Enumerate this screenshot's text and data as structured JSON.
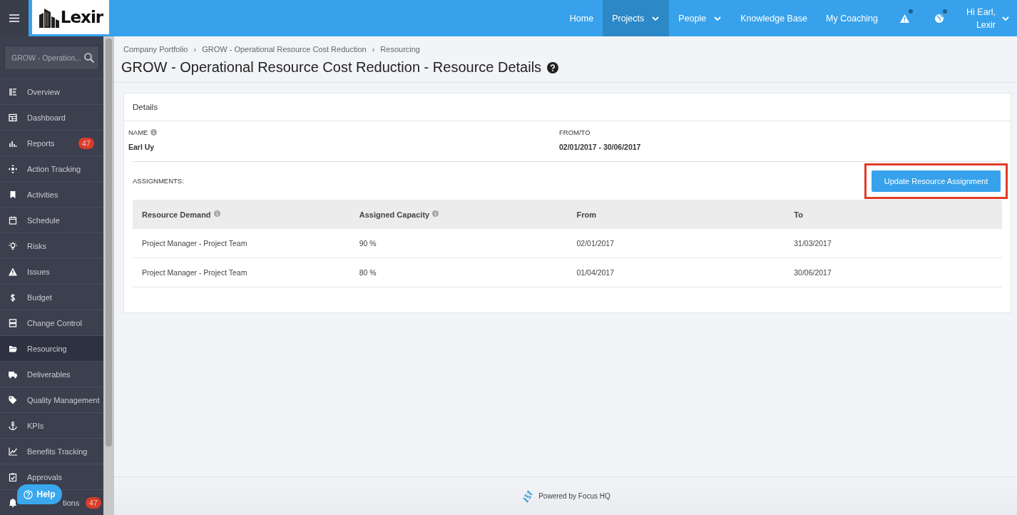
{
  "topbar": {
    "logo": "Lexir",
    "nav": [
      {
        "label": "Home",
        "selected": false,
        "dropdown": false
      },
      {
        "label": "Projects",
        "selected": true,
        "dropdown": true
      },
      {
        "label": "People",
        "selected": false,
        "dropdown": true
      },
      {
        "label": "Knowledge Base",
        "selected": false,
        "dropdown": false
      },
      {
        "label": "My Coaching",
        "selected": false,
        "dropdown": false
      }
    ],
    "user": {
      "greeting": "Hi Earl,",
      "name": "Lexir"
    }
  },
  "sidebar": {
    "search": {
      "value": "GROW - Operation..."
    },
    "items": [
      {
        "label": "Overview",
        "selected": false
      },
      {
        "label": "Dashboard",
        "selected": false
      },
      {
        "label": "Reports",
        "selected": false,
        "badge": "47"
      },
      {
        "label": "Action Tracking",
        "selected": false
      },
      {
        "label": "Activities",
        "selected": false
      },
      {
        "label": "Schedule",
        "selected": false
      },
      {
        "label": "Risks",
        "selected": false
      },
      {
        "label": "Issues",
        "selected": false
      },
      {
        "label": "Budget",
        "selected": false
      },
      {
        "label": "Change Control",
        "selected": false
      },
      {
        "label": "Resourcing",
        "selected": true
      },
      {
        "label": "Deliverables",
        "selected": false
      },
      {
        "label": "Quality Management",
        "selected": false
      },
      {
        "label": "KPIs",
        "selected": false
      },
      {
        "label": "Benefits Tracking",
        "selected": false
      },
      {
        "label": "Approvals",
        "selected": false
      },
      {
        "label": "tions",
        "selected": false,
        "badge": "47"
      }
    ]
  },
  "help_button": "Help",
  "breadcrumb": {
    "separator": "›",
    "items": [
      "Company Portfolio",
      "GROW - Operational Resource Cost Reduction",
      "Resourcing"
    ]
  },
  "page_title": "GROW - Operational Resource Cost Reduction - Resource Details",
  "details": {
    "header": "Details",
    "fields": [
      {
        "label": "NAME",
        "info": true,
        "value": "Earl Uy"
      },
      {
        "label": "FROM/TO",
        "info": false,
        "value": "02/01/2017 - 30/06/2017"
      }
    ],
    "assignments_label": "ASSIGNMENTS:",
    "update_button": {
      "label": "Update Resource Assignment",
      "highlighted": true
    },
    "table": {
      "columns": [
        {
          "label": "Resource Demand",
          "info": true
        },
        {
          "label": "Assigned Capacity",
          "info": true
        },
        {
          "label": "From",
          "info": false
        },
        {
          "label": "To",
          "info": false
        }
      ],
      "rows": [
        [
          "Project Manager - Project Team",
          "90 %",
          "02/01/2017",
          "31/03/2017"
        ],
        [
          "Project Manager - Project Team",
          "80 %",
          "01/04/2017",
          "30/06/2017"
        ]
      ]
    }
  },
  "footer": "Powered by Focus HQ"
}
